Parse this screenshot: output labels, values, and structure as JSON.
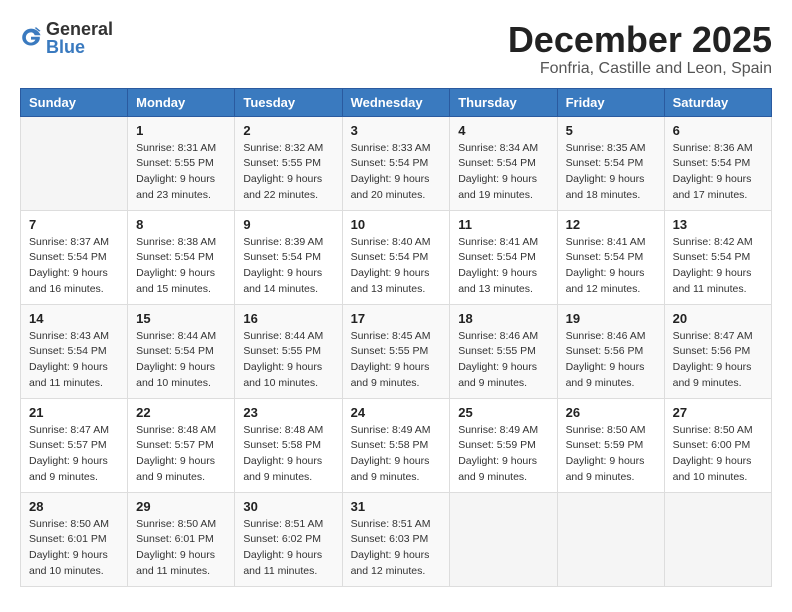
{
  "logo": {
    "general": "General",
    "blue": "Blue"
  },
  "title": "December 2025",
  "subtitle": "Fonfria, Castille and Leon, Spain",
  "days_header": [
    "Sunday",
    "Monday",
    "Tuesday",
    "Wednesday",
    "Thursday",
    "Friday",
    "Saturday"
  ],
  "weeks": [
    [
      {
        "day": "",
        "info": ""
      },
      {
        "day": "1",
        "info": "Sunrise: 8:31 AM\nSunset: 5:55 PM\nDaylight: 9 hours\nand 23 minutes."
      },
      {
        "day": "2",
        "info": "Sunrise: 8:32 AM\nSunset: 5:55 PM\nDaylight: 9 hours\nand 22 minutes."
      },
      {
        "day": "3",
        "info": "Sunrise: 8:33 AM\nSunset: 5:54 PM\nDaylight: 9 hours\nand 20 minutes."
      },
      {
        "day": "4",
        "info": "Sunrise: 8:34 AM\nSunset: 5:54 PM\nDaylight: 9 hours\nand 19 minutes."
      },
      {
        "day": "5",
        "info": "Sunrise: 8:35 AM\nSunset: 5:54 PM\nDaylight: 9 hours\nand 18 minutes."
      },
      {
        "day": "6",
        "info": "Sunrise: 8:36 AM\nSunset: 5:54 PM\nDaylight: 9 hours\nand 17 minutes."
      }
    ],
    [
      {
        "day": "7",
        "info": "Sunrise: 8:37 AM\nSunset: 5:54 PM\nDaylight: 9 hours\nand 16 minutes."
      },
      {
        "day": "8",
        "info": "Sunrise: 8:38 AM\nSunset: 5:54 PM\nDaylight: 9 hours\nand 15 minutes."
      },
      {
        "day": "9",
        "info": "Sunrise: 8:39 AM\nSunset: 5:54 PM\nDaylight: 9 hours\nand 14 minutes."
      },
      {
        "day": "10",
        "info": "Sunrise: 8:40 AM\nSunset: 5:54 PM\nDaylight: 9 hours\nand 13 minutes."
      },
      {
        "day": "11",
        "info": "Sunrise: 8:41 AM\nSunset: 5:54 PM\nDaylight: 9 hours\nand 13 minutes."
      },
      {
        "day": "12",
        "info": "Sunrise: 8:41 AM\nSunset: 5:54 PM\nDaylight: 9 hours\nand 12 minutes."
      },
      {
        "day": "13",
        "info": "Sunrise: 8:42 AM\nSunset: 5:54 PM\nDaylight: 9 hours\nand 11 minutes."
      }
    ],
    [
      {
        "day": "14",
        "info": "Sunrise: 8:43 AM\nSunset: 5:54 PM\nDaylight: 9 hours\nand 11 minutes."
      },
      {
        "day": "15",
        "info": "Sunrise: 8:44 AM\nSunset: 5:54 PM\nDaylight: 9 hours\nand 10 minutes."
      },
      {
        "day": "16",
        "info": "Sunrise: 8:44 AM\nSunset: 5:55 PM\nDaylight: 9 hours\nand 10 minutes."
      },
      {
        "day": "17",
        "info": "Sunrise: 8:45 AM\nSunset: 5:55 PM\nDaylight: 9 hours\nand 9 minutes."
      },
      {
        "day": "18",
        "info": "Sunrise: 8:46 AM\nSunset: 5:55 PM\nDaylight: 9 hours\nand 9 minutes."
      },
      {
        "day": "19",
        "info": "Sunrise: 8:46 AM\nSunset: 5:56 PM\nDaylight: 9 hours\nand 9 minutes."
      },
      {
        "day": "20",
        "info": "Sunrise: 8:47 AM\nSunset: 5:56 PM\nDaylight: 9 hours\nand 9 minutes."
      }
    ],
    [
      {
        "day": "21",
        "info": "Sunrise: 8:47 AM\nSunset: 5:57 PM\nDaylight: 9 hours\nand 9 minutes."
      },
      {
        "day": "22",
        "info": "Sunrise: 8:48 AM\nSunset: 5:57 PM\nDaylight: 9 hours\nand 9 minutes."
      },
      {
        "day": "23",
        "info": "Sunrise: 8:48 AM\nSunset: 5:58 PM\nDaylight: 9 hours\nand 9 minutes."
      },
      {
        "day": "24",
        "info": "Sunrise: 8:49 AM\nSunset: 5:58 PM\nDaylight: 9 hours\nand 9 minutes."
      },
      {
        "day": "25",
        "info": "Sunrise: 8:49 AM\nSunset: 5:59 PM\nDaylight: 9 hours\nand 9 minutes."
      },
      {
        "day": "26",
        "info": "Sunrise: 8:50 AM\nSunset: 5:59 PM\nDaylight: 9 hours\nand 9 minutes."
      },
      {
        "day": "27",
        "info": "Sunrise: 8:50 AM\nSunset: 6:00 PM\nDaylight: 9 hours\nand 10 minutes."
      }
    ],
    [
      {
        "day": "28",
        "info": "Sunrise: 8:50 AM\nSunset: 6:01 PM\nDaylight: 9 hours\nand 10 minutes."
      },
      {
        "day": "29",
        "info": "Sunrise: 8:50 AM\nSunset: 6:01 PM\nDaylight: 9 hours\nand 11 minutes."
      },
      {
        "day": "30",
        "info": "Sunrise: 8:51 AM\nSunset: 6:02 PM\nDaylight: 9 hours\nand 11 minutes."
      },
      {
        "day": "31",
        "info": "Sunrise: 8:51 AM\nSunset: 6:03 PM\nDaylight: 9 hours\nand 12 minutes."
      },
      {
        "day": "",
        "info": ""
      },
      {
        "day": "",
        "info": ""
      },
      {
        "day": "",
        "info": ""
      }
    ]
  ]
}
